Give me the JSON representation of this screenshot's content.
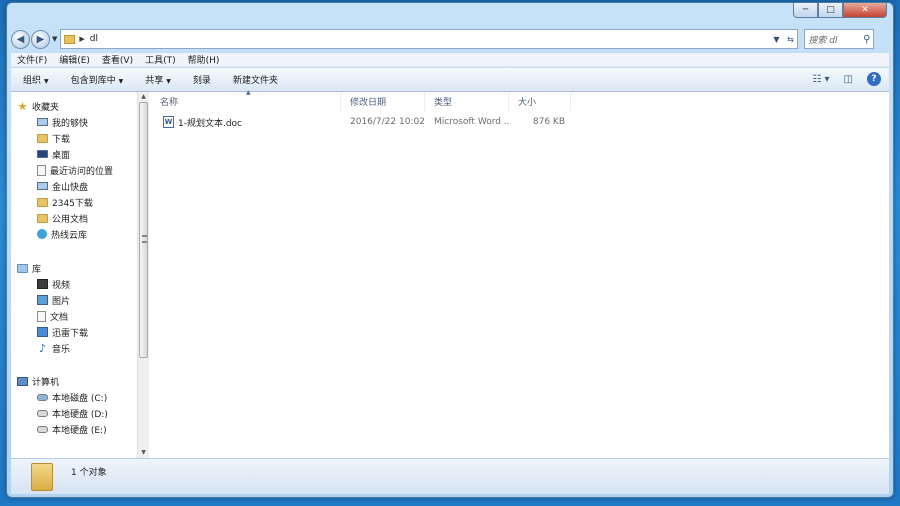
{
  "window": {
    "controls": {
      "minimize": "─",
      "maximize": "□",
      "close": "✕"
    }
  },
  "address": {
    "path": "dl",
    "search_placeholder": "搜索 dl"
  },
  "menu": [
    "文件(F)",
    "编辑(E)",
    "查看(V)",
    "工具(T)",
    "帮助(H)"
  ],
  "toolbar": {
    "organize": "组织",
    "include_in_library": "包含到库中",
    "share": "共享",
    "burn": "刻录",
    "new_folder": "新建文件夹"
  },
  "nav": {
    "favorites": {
      "title": "收藏夹",
      "items": [
        "我的够快",
        "下载",
        "桌面",
        "最近访问的位置",
        "金山快盘",
        "2345下载",
        "公用文档",
        "热线云库"
      ]
    },
    "libraries": {
      "title": "库",
      "items": [
        "视频",
        "图片",
        "文档",
        "迅雷下载",
        "音乐"
      ]
    },
    "computer": {
      "title": "计算机",
      "items": [
        "本地磁盘 (C:)",
        "本地硬盘 (D:)",
        "本地硬盘 (E:)"
      ]
    }
  },
  "columns": {
    "name": "名称",
    "date": "修改日期",
    "type": "类型",
    "size": "大小"
  },
  "files": [
    {
      "name": "1-规划文本.doc",
      "date": "2016/7/22 10:02",
      "type": "Microsoft Word ...",
      "size": "876 KB",
      "icon": "word-doc-icon"
    }
  ],
  "status": {
    "count": "1 个对象"
  },
  "colors": {
    "accent": "#2f6ec6",
    "desktop": "#2a8ed8"
  }
}
